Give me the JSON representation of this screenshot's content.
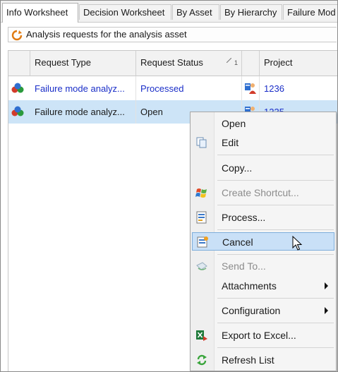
{
  "tabs": [
    {
      "label": "Info Worksheet",
      "active": true
    },
    {
      "label": "Decision Worksheet",
      "active": false
    },
    {
      "label": "By Asset",
      "active": false
    },
    {
      "label": "By Hierarchy",
      "active": false
    },
    {
      "label": "Failure Mod",
      "active": false
    }
  ],
  "caption": {
    "text": "Analysis requests for the analysis asset"
  },
  "grid": {
    "columns": [
      "Request Type",
      "Request Status",
      "Project"
    ],
    "sort": {
      "column": "Request Status",
      "order": "1"
    },
    "rows": [
      {
        "type": "Failure mode analyz...",
        "status": "Processed",
        "project": "1236",
        "selected": false
      },
      {
        "type": "Failure mode analyz...",
        "status": "Open",
        "project": "1235",
        "selected": true
      }
    ]
  },
  "context_menu": {
    "items": [
      {
        "label": "Open",
        "icon": "none"
      },
      {
        "label": "Edit",
        "icon": "edit-icon"
      },
      {
        "label": "Copy...",
        "icon": "none"
      },
      {
        "label": "Create Shortcut...",
        "icon": "windows-flag-icon",
        "disabled": true
      },
      {
        "label": "Process...",
        "icon": "process-icon"
      },
      {
        "label": "Cancel",
        "icon": "cancel-icon",
        "hover": true
      },
      {
        "label": "Send To...",
        "icon": "send-to-icon",
        "disabled": true
      },
      {
        "label": "Attachments",
        "icon": "none",
        "submenu": true
      },
      {
        "label": "Configuration",
        "icon": "none",
        "submenu": true
      },
      {
        "label": "Export to Excel...",
        "icon": "excel-icon"
      },
      {
        "label": "Refresh List",
        "icon": "refresh-icon"
      }
    ]
  },
  "colors": {
    "link": "#1a2ec8",
    "selected_row": "#cde4f7",
    "menu_hover": "#c9e0f7",
    "menu_hover_border": "#7eaedb"
  }
}
